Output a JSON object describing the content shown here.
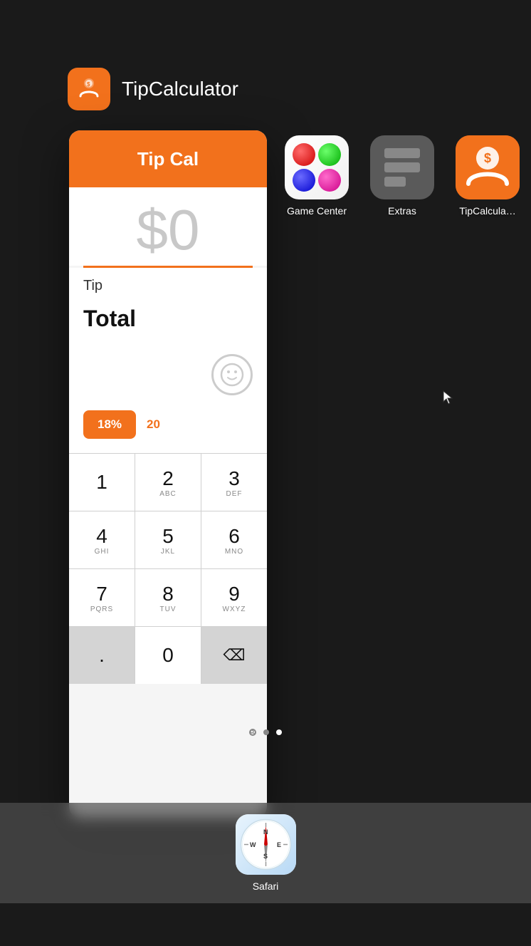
{
  "app_label": {
    "title": "TipCalculator"
  },
  "tip_calc_card": {
    "header": "Tip Cal",
    "amount": "$0",
    "tip_label": "Tip",
    "total_label": "Total",
    "tip_pct_active": "18%",
    "tip_pct_inactive": "20"
  },
  "numpad": {
    "rows": [
      [
        {
          "digit": "1",
          "letters": ""
        },
        {
          "digit": "2",
          "letters": "ABC"
        },
        {
          "digit": "3",
          "letters": "DEF"
        }
      ],
      [
        {
          "digit": "4",
          "letters": "GHI"
        },
        {
          "digit": "5",
          "letters": "JKL"
        },
        {
          "digit": "6",
          "letters": "MNO"
        }
      ],
      [
        {
          "digit": "7",
          "letters": "PQRS"
        },
        {
          "digit": "8",
          "letters": "TUV"
        },
        {
          "digit": "9",
          "letters": "WXYZ"
        }
      ],
      [
        {
          "digit": ".",
          "letters": "",
          "gray": true
        },
        {
          "digit": "0",
          "letters": ""
        },
        {
          "digit": "⌫",
          "letters": "",
          "gray": false
        }
      ]
    ]
  },
  "home_icons": [
    {
      "name": "Game Center",
      "type": "game-center"
    },
    {
      "name": "Extras",
      "type": "extras"
    },
    {
      "name": "TipCalcula…",
      "type": "tip-calc"
    }
  ],
  "page_dots": {
    "dots": [
      "search",
      "inactive",
      "active"
    ]
  },
  "dock": {
    "items": [
      {
        "label": "Safari",
        "type": "safari"
      }
    ]
  },
  "colors": {
    "orange": "#f2711c",
    "white": "#ffffff",
    "black": "#000000"
  }
}
